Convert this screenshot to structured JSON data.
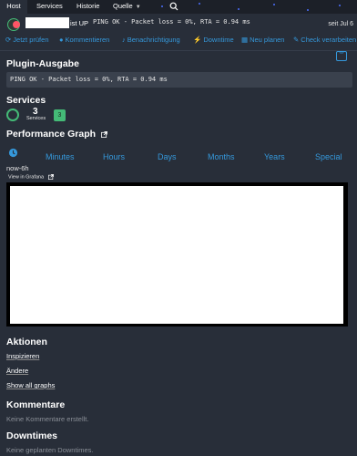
{
  "tabs": [
    {
      "label": "Host"
    },
    {
      "label": "Services"
    },
    {
      "label": "Historie"
    },
    {
      "label": "Quelle"
    }
  ],
  "header": {
    "host_state": "ist UP",
    "plugin_line": "PING OK - Packet loss = 0%, RTA = 0.94 ms",
    "since": "seit Jul 6"
  },
  "actions": [
    {
      "label": "Jetzt prüfen",
      "icon": "refresh-icon"
    },
    {
      "label": "Kommentieren",
      "icon": "comment-icon"
    },
    {
      "label": "Benachrichtigung",
      "icon": "bell-icon"
    },
    {
      "label": "Downtime",
      "icon": "plug-icon"
    },
    {
      "label": "Neu planen",
      "icon": "calendar-icon"
    },
    {
      "label": "Check verarbeiten",
      "icon": "edit-icon"
    }
  ],
  "plugin_section": {
    "title": "Plugin-Ausgabe",
    "output": "PING OK - Packet loss = 0%, RTA = 0.94 ms"
  },
  "services": {
    "title": "Services",
    "count": "3",
    "label": "Services",
    "ok_badge": "3"
  },
  "perf": {
    "title": "Performance Graph",
    "ranges": [
      "Minutes",
      "Hours",
      "Days",
      "Months",
      "Years",
      "Special"
    ],
    "current_range": "now-6h",
    "grafana_link": "View in Grafana"
  },
  "aktionen": {
    "title": "Aktionen",
    "links": [
      "Inspizieren",
      "Ändere",
      "Show all graphs"
    ]
  },
  "kommentare": {
    "title": "Kommentare",
    "empty": "Keine Kommentare erstellt."
  },
  "downtimes": {
    "title": "Downtimes",
    "empty": "Keine geplanten Downtimes."
  },
  "colors": {
    "background": "#282e39",
    "accent": "#3598db",
    "ok": "#44bb77",
    "critical": "#ff5566"
  }
}
